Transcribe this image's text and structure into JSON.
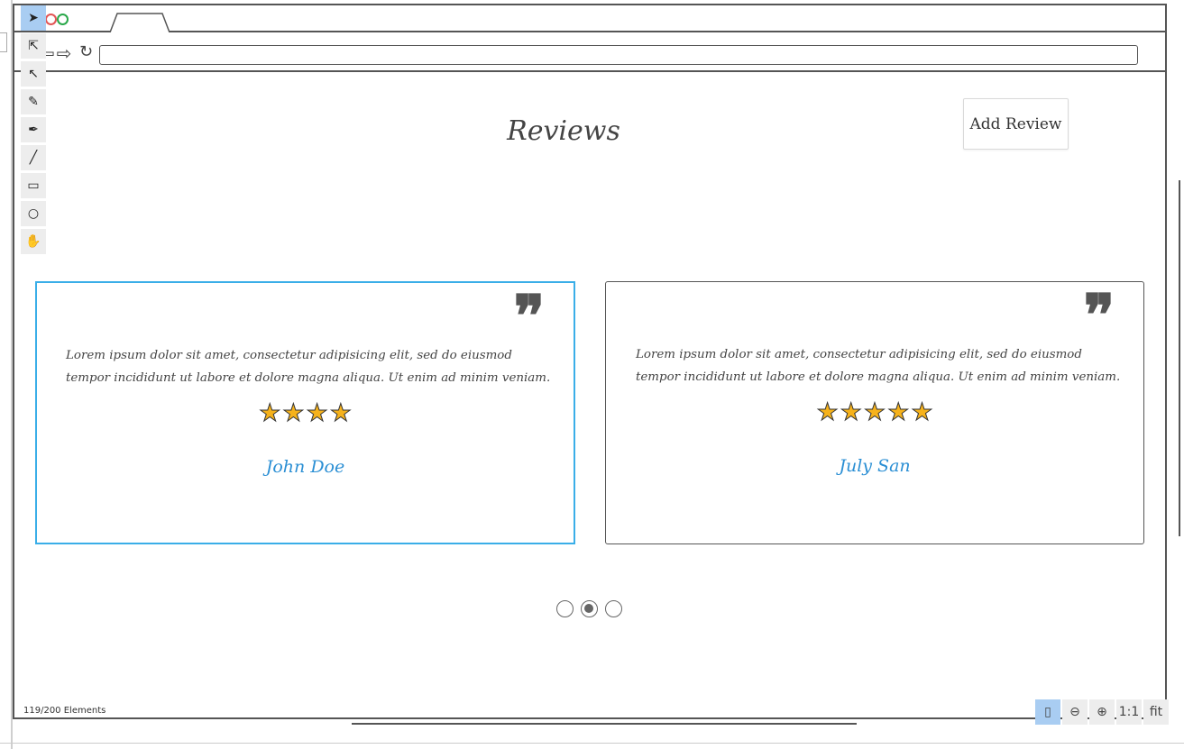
{
  "status": {
    "element_count": "119/200 Elements"
  },
  "toolbar": {
    "tools": [
      {
        "name": "select-arrow-icon",
        "glyph": "➤"
      },
      {
        "name": "direct-select-icon",
        "glyph": "⇱"
      },
      {
        "name": "lasso-select-icon",
        "glyph": "↖"
      },
      {
        "name": "pencil-icon",
        "glyph": "✎"
      },
      {
        "name": "pen-icon",
        "glyph": "✒"
      },
      {
        "name": "line-icon",
        "glyph": "╱"
      },
      {
        "name": "rectangle-icon",
        "glyph": "▭"
      },
      {
        "name": "ellipse-icon",
        "glyph": "○"
      },
      {
        "name": "hand-icon",
        "glyph": "✋"
      }
    ]
  },
  "browser": {
    "nav_glyphs": "⇦⇨",
    "refresh_glyph": "↻"
  },
  "page": {
    "title": "Reviews",
    "add_review_label": "Add Review",
    "reviews": [
      {
        "text": "Lorem ipsum dolor sit amet, consectetur adipisicing elit, sed do eiusmod tempor incididunt ut labore et dolore magna aliqua. Ut enim ad minim veniam.",
        "rating": 4,
        "name": "John Doe"
      },
      {
        "text": "Lorem ipsum dolor sit amet, consectetur adipisicing elit, sed do eiusmod tempor incididunt ut labore et dolore magna aliqua. Ut enim ad minim veniam.",
        "rating": 5,
        "name": "July San"
      }
    ],
    "pager": {
      "count": 3,
      "active_index": 1
    }
  },
  "zoom": {
    "buttons": [
      {
        "name": "device-view-button",
        "glyph": "▯"
      },
      {
        "name": "zoom-out-button",
        "glyph": "⊖"
      },
      {
        "name": "zoom-in-button",
        "glyph": "⊕"
      },
      {
        "name": "zoom-actual-size-button",
        "glyph": "1:1"
      },
      {
        "name": "zoom-fit-button",
        "glyph": "fit"
      }
    ]
  },
  "colors": {
    "accent_blue": "#3aaee8",
    "name_blue": "#2b8fd4",
    "star_gold": "#f6b21b",
    "tool_active": "#a9cdf2"
  }
}
